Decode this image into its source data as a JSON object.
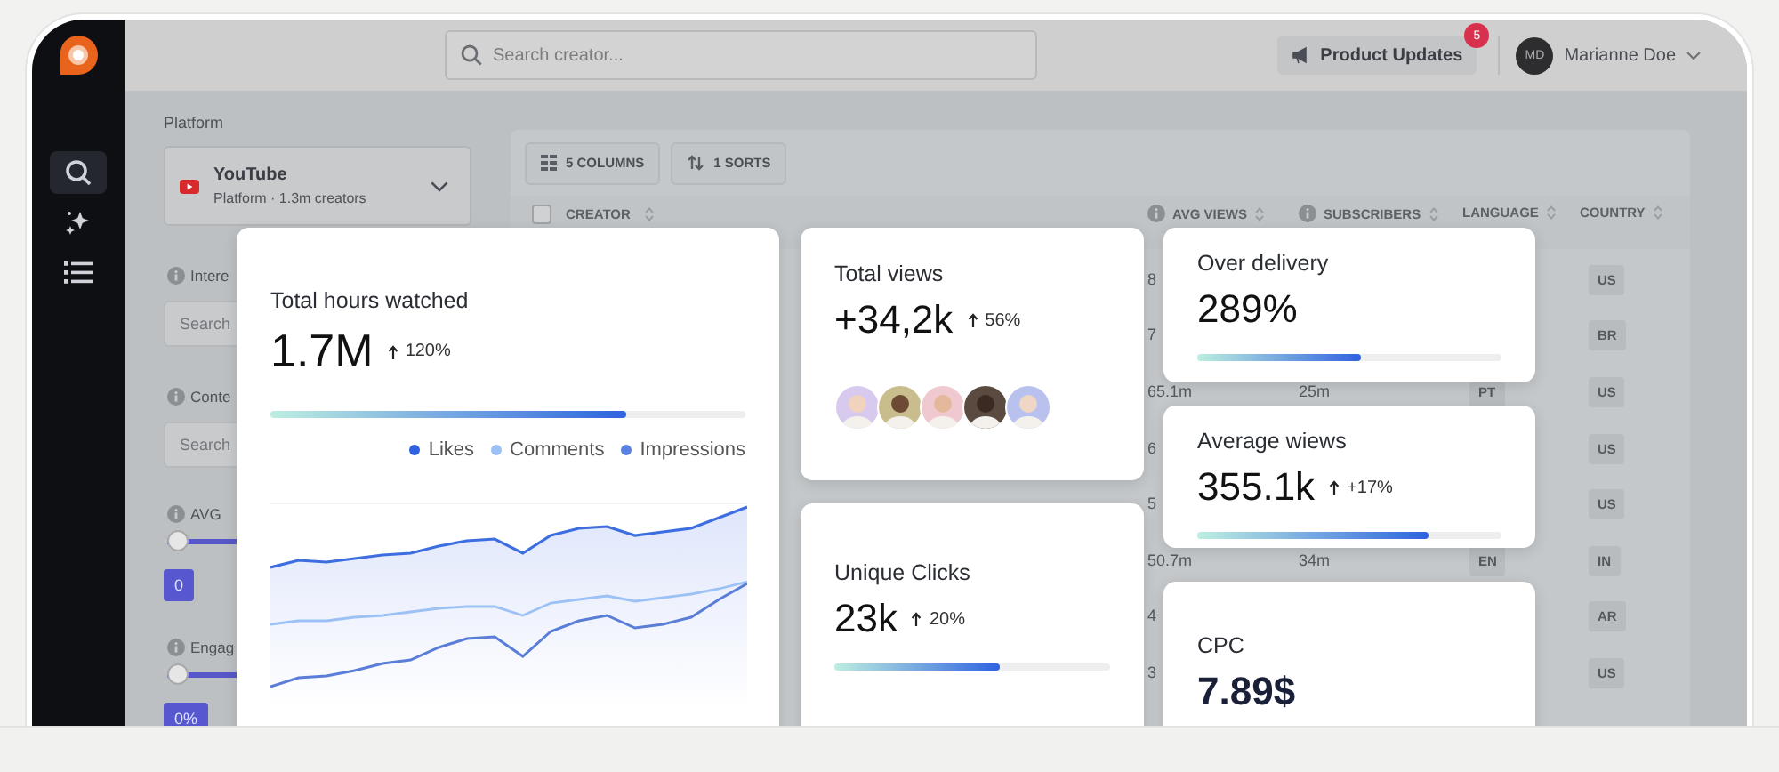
{
  "sidebar": {
    "items": [
      {
        "kind": "search",
        "selected": true
      },
      {
        "kind": "sparkle",
        "selected": false
      },
      {
        "kind": "list",
        "selected": false
      }
    ]
  },
  "topbar": {
    "search": {
      "placeholder": "Search creator..."
    },
    "updates": {
      "label": "Product Updates",
      "badge": "5"
    },
    "user": {
      "initials": "MD",
      "name": "Marianne Doe"
    }
  },
  "filters": {
    "platform": {
      "label": "Platform",
      "value": "YouTube",
      "detail": "Platform · 1.3m creators"
    },
    "sections": [
      {
        "kind": "search",
        "label": "Intere",
        "placeholder": "Search"
      },
      {
        "kind": "search",
        "label": "Conte",
        "placeholder": "Search"
      },
      {
        "kind": "slider",
        "label": "AVG",
        "level": 0,
        "value": "0"
      },
      {
        "kind": "slider",
        "label": "Engag",
        "level": 0,
        "value": "0%"
      }
    ]
  },
  "table": {
    "toolbar": [
      {
        "kind": "columns",
        "label": "5 COLUMNS"
      },
      {
        "kind": "sorts",
        "label": "1 SORTS"
      }
    ],
    "select_all": {
      "checked": false
    },
    "columns": [
      {
        "label": "CREATOR",
        "info": false
      },
      {
        "label": "AVG VIEWS",
        "info": true
      },
      {
        "label": "SUBSCRIBERS",
        "info": true
      },
      {
        "label": "LANGUAGE",
        "info": false
      },
      {
        "label": "COUNTRY",
        "info": false
      }
    ],
    "rows": [
      {
        "avg_views": "8",
        "country": "US"
      },
      {
        "avg_views": "7",
        "country": "BR"
      },
      {
        "avg_views": "65.1m",
        "subscribers": "25m",
        "language": "PT",
        "country": "US"
      },
      {
        "avg_views": "6",
        "country": "US"
      },
      {
        "avg_views": "5",
        "country": "US"
      },
      {
        "avg_views": "50.7m",
        "subscribers": "34m",
        "language": "EN",
        "country": "IN"
      },
      {
        "avg_views": "4",
        "country": "AR"
      },
      {
        "avg_views": "3",
        "country": "US"
      }
    ]
  },
  "cards": [
    {
      "title": "Total hours watched",
      "value": "1.7M",
      "trend": "120%",
      "level": 0.75,
      "legend": [
        {
          "label": "Likes",
          "color": "#2f62e0"
        },
        {
          "label": "Comments",
          "color": "#9cc1f5"
        },
        {
          "label": "Impressions",
          "color": "#5a82e0"
        }
      ],
      "chart": {
        "kind": "picture"
      }
    },
    {
      "title": "Total views",
      "value": "+34,2k",
      "trend": "56%",
      "avatars": [
        {
          "kind": "picture"
        },
        {
          "kind": "picture"
        },
        {
          "kind": "picture"
        },
        {
          "kind": "picture"
        },
        {
          "kind": "picture"
        }
      ]
    },
    {
      "title": "Unique Clicks",
      "value": "23k",
      "trend": "20%",
      "level": 0.6
    },
    {
      "title": "Over delivery",
      "value": "289%",
      "level": 0.54
    },
    {
      "title": "Average wiews",
      "value": "355.1k",
      "trend": "+17%",
      "level": 0.76
    },
    {
      "title": "CPC",
      "value": "7.89$"
    }
  ]
}
